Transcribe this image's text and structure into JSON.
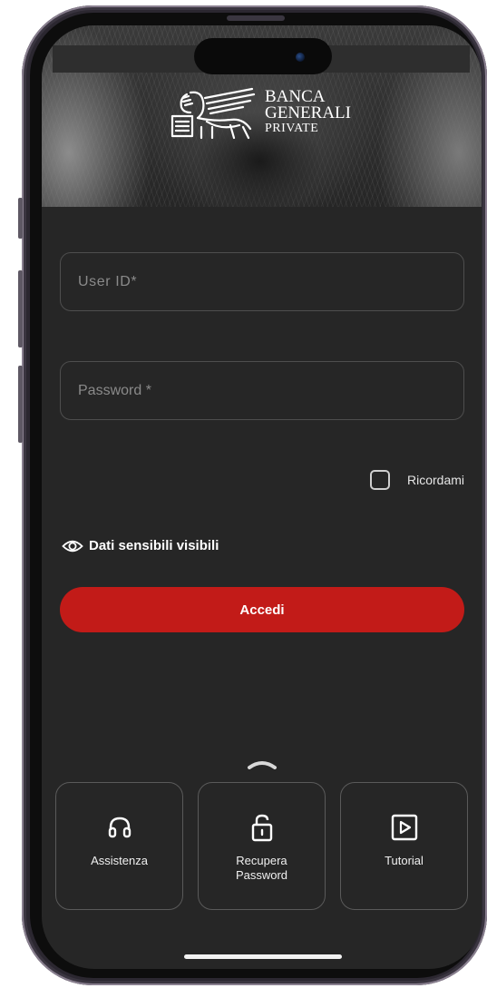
{
  "brand": {
    "line1": "BANCA",
    "line2": "GENERALI",
    "line3": "PRIVATE"
  },
  "login": {
    "user_placeholder": "User ID*",
    "password_placeholder": "Password *",
    "remember_label": "Ricordami",
    "sensitive_label": "Dati sensibili visibili",
    "submit_label": "Accedi"
  },
  "quick_actions": [
    {
      "label": "Assistenza",
      "icon": "headset-icon"
    },
    {
      "label": "Recupera\nPassword",
      "icon": "unlock-icon"
    },
    {
      "label": "Tutorial",
      "icon": "play-icon"
    }
  ],
  "colors": {
    "background": "#262626",
    "accent": "#c21b18",
    "border": "#4e4e4e",
    "text": "#ffffff"
  }
}
